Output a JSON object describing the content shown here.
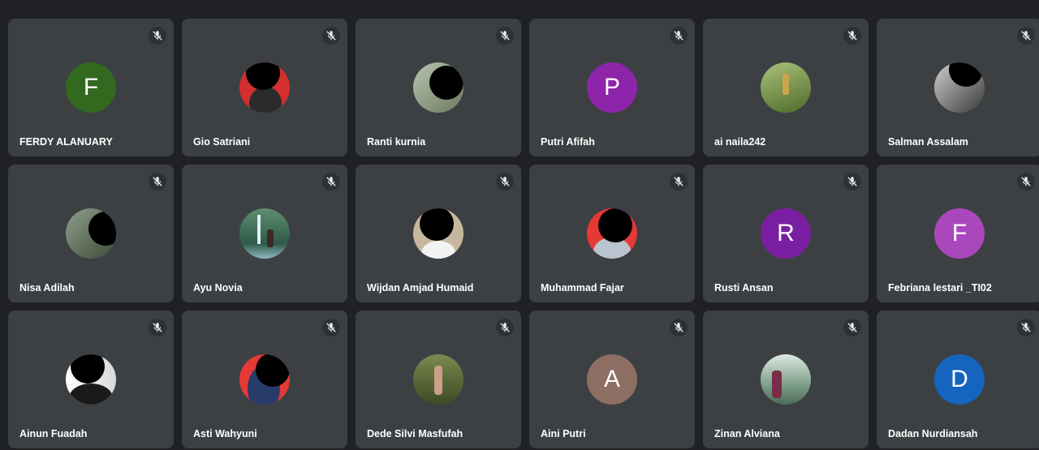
{
  "participants": [
    {
      "name": "FERDY ALANUARY",
      "initial": "F",
      "avatar_color": "#33691e"
    },
    {
      "name": "Gio Satriani",
      "photo": "red-bg-photo",
      "avatar_color": "#d32f2f"
    },
    {
      "name": "Ranti kurnia",
      "photo": "outdoor-photo",
      "avatar_color": "#8d9b86"
    },
    {
      "name": "Putri Afifah",
      "initial": "P",
      "avatar_color": "#8e24aa"
    },
    {
      "name": "ai naila242",
      "photo": "field-photo",
      "avatar_color": "#6f8f3a"
    },
    {
      "name": "Salman Assalam",
      "photo": "dark-photo",
      "avatar_color": "#4a4a4a"
    },
    {
      "name": "Nisa Adilah",
      "photo": "outdoor-photo",
      "avatar_color": "#6d7a6c"
    },
    {
      "name": "Ayu Novia",
      "photo": "waterfall-photo",
      "avatar_color": "#4f7f6a"
    },
    {
      "name": "Wijdan Amjad Humaid",
      "photo": "portrait-photo",
      "avatar_color": "#c7b79e"
    },
    {
      "name": "Muhammad Fajar",
      "photo": "red-bg-photo",
      "avatar_color": "#e53935"
    },
    {
      "name": "Rusti Ansan",
      "initial": "R",
      "avatar_color": "#7b1fa2"
    },
    {
      "name": "Febriana lestari _TI02",
      "initial": "F",
      "avatar_color": "#ab47bc"
    },
    {
      "name": "Ainun Fuadah",
      "photo": "bw-photo",
      "avatar_color": "#e0e0e0"
    },
    {
      "name": "Asti Wahyuni",
      "photo": "red-bg-photo",
      "avatar_color": "#e53935"
    },
    {
      "name": "Dede Silvi Masfufah",
      "photo": "garden-photo",
      "avatar_color": "#5d6b3e"
    },
    {
      "name": "Aini Putri",
      "initial": "A",
      "avatar_color": "#8d6e63"
    },
    {
      "name": "Zinan Alviana",
      "photo": "lake-photo",
      "avatar_color": "#7fa08a"
    },
    {
      "name": "Dadan Nurdiansah",
      "initial": "D",
      "avatar_color": "#1565c0"
    }
  ],
  "icons": {
    "mic_state": "mic-off-icon"
  }
}
